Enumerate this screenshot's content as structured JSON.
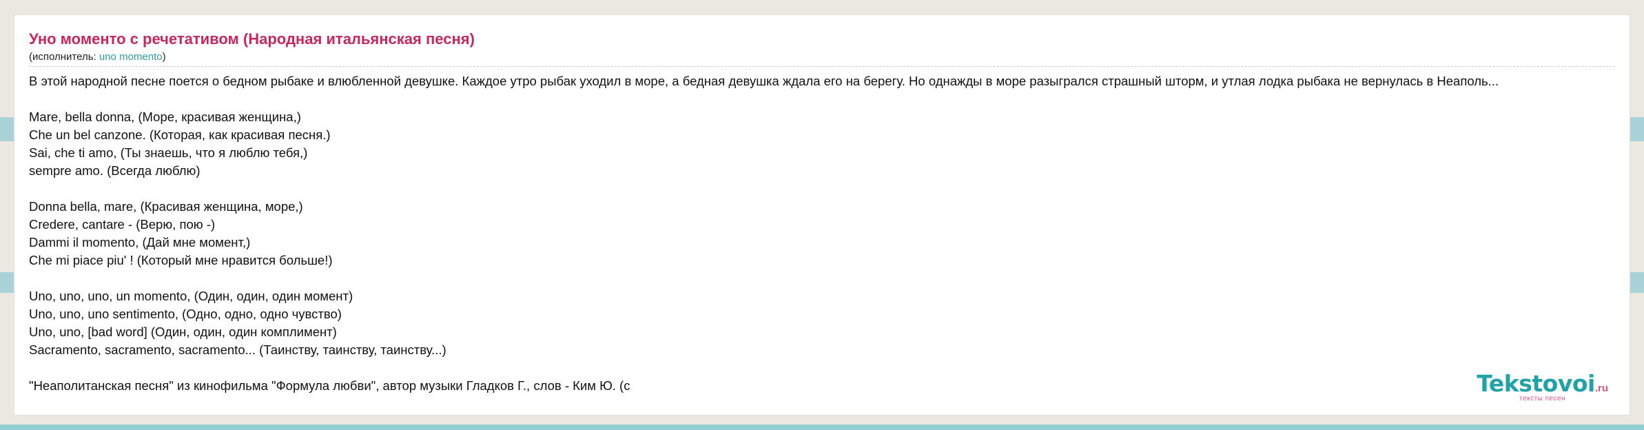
{
  "song": {
    "title": "Уно моменто с речетативом (Народная итальянская песня)",
    "performer_prefix": "(исполнитель: ",
    "performer_name": "uno momento",
    "performer_suffix": ")"
  },
  "intro": "В этой народной песне поется о бедном рыбаке и влюбленной девушке. Каждое утро рыбак уходил в море, а бедная девушка ждала его на берегу. Но однажды в море разыгрался страшный шторм, и утлая лодка рыбака не вернулась в Неаполь...",
  "verses": [
    [
      "Mare, bella donna, (Море, красивая женщина,)",
      "Che un bel canzone. (Которая, как красивая песня.)",
      "Sai, che ti amo, (Ты знаешь, что я люблю тебя,)",
      "sempre amo. (Всегда люблю)"
    ],
    [
      "Donna bella, mare, (Красивая женщина, море,)",
      "Credere, cantare - (Верю, пою -)",
      "Dammi il momento, (Дай мне момент,)",
      "Che mi piace piu' ! (Который мне нравится больше!)"
    ],
    [
      "Uno, uno, uno, un momento, (Один, один, один момент)",
      "Uno, uno, uno sentimento, (Одно, одно, одно чувство)",
      "Uno, uno, [bad word] (Один, один, один комплимент)",
      "Sacramento, sacramento, sacramento... (Таинству, таинству, таинству...)"
    ],
    [
      "\"Неаполитанская песня\" из кинофильма \"Формула любви\", автор музыки Гладков Г., слов - Ким Ю. (с"
    ]
  ],
  "logo": {
    "name": "Tekstovoi",
    "tld": ".ru",
    "tagline": "тексты песен"
  },
  "colors": {
    "title": "#c8275c",
    "link": "#2d9aa3",
    "logo": "#1fa2a8",
    "logo_accent": "#e0557f"
  }
}
